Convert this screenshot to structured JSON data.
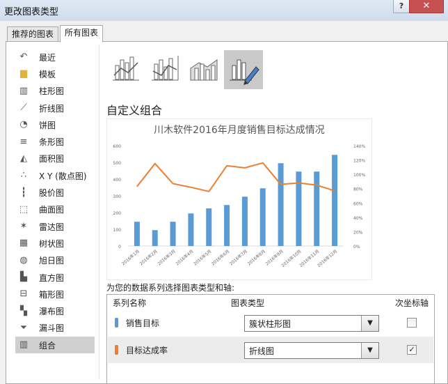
{
  "window": {
    "title": "更改图表类型",
    "help_label": "?",
    "close_label": "✕"
  },
  "tabs": [
    {
      "label": "推荐的图表"
    },
    {
      "label": "所有图表"
    }
  ],
  "sidebar": {
    "items": [
      {
        "label": "最近",
        "icon": "recent-icon"
      },
      {
        "label": "模板",
        "icon": "folder-icon"
      },
      {
        "label": "柱形图",
        "icon": "column-chart-icon"
      },
      {
        "label": "折线图",
        "icon": "line-chart-icon"
      },
      {
        "label": "饼图",
        "icon": "pie-chart-icon"
      },
      {
        "label": "条形图",
        "icon": "bar-chart-icon"
      },
      {
        "label": "面积图",
        "icon": "area-chart-icon"
      },
      {
        "label": "X Y (散点图)",
        "icon": "scatter-chart-icon"
      },
      {
        "label": "股价图",
        "icon": "stock-chart-icon"
      },
      {
        "label": "曲面图",
        "icon": "surface-chart-icon"
      },
      {
        "label": "雷达图",
        "icon": "radar-chart-icon"
      },
      {
        "label": "树状图",
        "icon": "treemap-chart-icon"
      },
      {
        "label": "旭日图",
        "icon": "sunburst-chart-icon"
      },
      {
        "label": "直方图",
        "icon": "histogram-chart-icon"
      },
      {
        "label": "箱形图",
        "icon": "box-chart-icon"
      },
      {
        "label": "瀑布图",
        "icon": "waterfall-chart-icon"
      },
      {
        "label": "漏斗图",
        "icon": "funnel-chart-icon"
      },
      {
        "label": "组合",
        "icon": "combo-chart-icon"
      }
    ],
    "selected_index": 17
  },
  "main": {
    "section_title": "自定义组合",
    "series_prompt": "为您的数据系列选择图表类型和轴:",
    "grid": {
      "col_series": "系列名称",
      "col_type": "图表类型",
      "col_axis": "次坐标轴",
      "rows": [
        {
          "name": "销售目标",
          "type": "簇状柱形图",
          "secondary": false
        },
        {
          "name": "目标达成率",
          "type": "折线图",
          "secondary": true
        }
      ]
    }
  },
  "colors": {
    "bar": "#5b9bd5",
    "line": "#ed7d31",
    "accent": "#c75050"
  },
  "chart_data": {
    "type": "bar",
    "title": "川木软件2016年月度销售目标达成情况",
    "categories": [
      "2016年1月",
      "2016年2月",
      "2016年3月",
      "2016年4月",
      "2016年5月",
      "2016年6月",
      "2016年7月",
      "2016年8月",
      "2016年9月",
      "2016年10月",
      "2016年11月",
      "2016年12月"
    ],
    "series": [
      {
        "values": [
          145,
          95,
          145,
          195,
          225,
          245,
          295,
          345,
          495,
          445,
          445,
          545
        ],
        "axis": "primary",
        "type": "bar"
      },
      {
        "values": [
          0.83,
          1.15,
          0.87,
          0.82,
          0.76,
          1.12,
          1.09,
          1.16,
          0.86,
          0.88,
          0.85,
          0.77
        ],
        "axis": "secondary",
        "type": "line"
      }
    ],
    "y_left": {
      "range": [
        0,
        600
      ],
      "ticks": [
        "0",
        "100",
        "200",
        "300",
        "400",
        "500",
        "600"
      ]
    },
    "y_right": {
      "range": [
        0,
        1.4
      ],
      "ticks": [
        "0%",
        "20%",
        "40%",
        "60%",
        "80%",
        "100%",
        "120%",
        "140%"
      ]
    },
    "grid": false,
    "legend": "none"
  }
}
